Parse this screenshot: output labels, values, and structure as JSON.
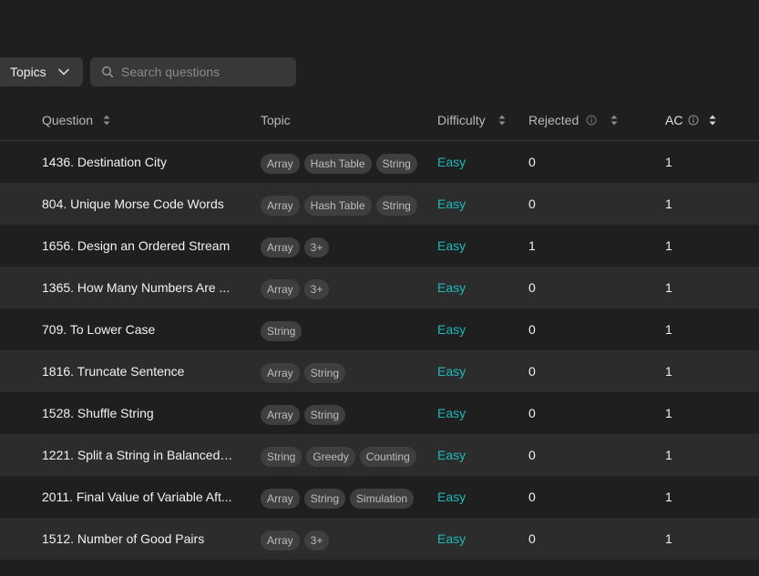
{
  "toolbar": {
    "topics_label": "Topics",
    "search_placeholder": "Search questions"
  },
  "columns": {
    "question": "Question",
    "topic": "Topic",
    "difficulty": "Difficulty",
    "rejected": "Rejected",
    "ac": "AC"
  },
  "colors": {
    "easy": "#1cbaba",
    "background": "#1f1f1f",
    "row_alt": "#2c2c2c"
  },
  "rows": [
    {
      "title": "1436. Destination City",
      "tags": [
        "Array",
        "Hash Table",
        "String"
      ],
      "difficulty": "Easy",
      "rejected": "0",
      "ac": "1"
    },
    {
      "title": "804. Unique Morse Code Words",
      "tags": [
        "Array",
        "Hash Table",
        "String"
      ],
      "difficulty": "Easy",
      "rejected": "0",
      "ac": "1"
    },
    {
      "title": "1656. Design an Ordered Stream",
      "tags": [
        "Array",
        "3+"
      ],
      "difficulty": "Easy",
      "rejected": "1",
      "ac": "1"
    },
    {
      "title": "1365. How Many Numbers Are ...",
      "tags": [
        "Array",
        "3+"
      ],
      "difficulty": "Easy",
      "rejected": "0",
      "ac": "1"
    },
    {
      "title": "709. To Lower Case",
      "tags": [
        "String"
      ],
      "difficulty": "Easy",
      "rejected": "0",
      "ac": "1"
    },
    {
      "title": "1816. Truncate Sentence",
      "tags": [
        "Array",
        "String"
      ],
      "difficulty": "Easy",
      "rejected": "0",
      "ac": "1"
    },
    {
      "title": "1528. Shuffle String",
      "tags": [
        "Array",
        "String"
      ],
      "difficulty": "Easy",
      "rejected": "0",
      "ac": "1"
    },
    {
      "title": "1221. Split a String in Balanced ...",
      "tags": [
        "String",
        "Greedy",
        "Counting"
      ],
      "difficulty": "Easy",
      "rejected": "0",
      "ac": "1"
    },
    {
      "title": "2011. Final Value of Variable Aft...",
      "tags": [
        "Array",
        "String",
        "Simulation"
      ],
      "difficulty": "Easy",
      "rejected": "0",
      "ac": "1"
    },
    {
      "title": "1512. Number of Good Pairs",
      "tags": [
        "Array",
        "3+"
      ],
      "difficulty": "Easy",
      "rejected": "0",
      "ac": "1"
    }
  ]
}
